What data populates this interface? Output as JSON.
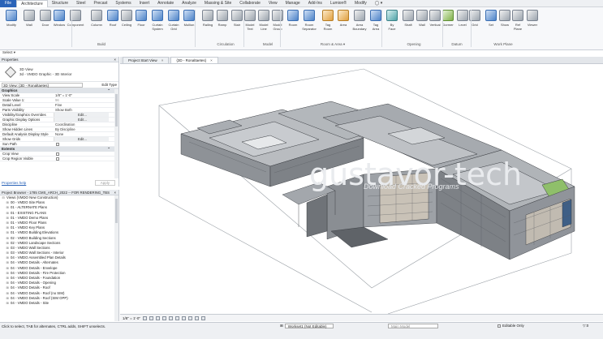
{
  "ribbon_tabs": [
    "File",
    "Architecture",
    "Structure",
    "Steel",
    "Precast",
    "Systems",
    "Insert",
    "Annotate",
    "Analyze",
    "Massing & Site",
    "Collaborate",
    "View",
    "Manage",
    "Add-Ins",
    "Lumion®",
    "Modify",
    "◯ ▾"
  ],
  "ribbon_active_tab": "Architecture",
  "tools": [
    {
      "label": "Modify",
      "color": "blue"
    },
    {
      "label": "Wall",
      "color": "grey"
    },
    {
      "label": "Door",
      "color": "grey"
    },
    {
      "label": "Window",
      "color": "blue"
    },
    {
      "label": "Component",
      "color": "grey"
    },
    {
      "label": "Column",
      "color": "grey"
    },
    {
      "label": "Roof",
      "color": "blue"
    },
    {
      "label": "Ceiling",
      "color": "grey"
    },
    {
      "label": "Floor",
      "color": "blue"
    },
    {
      "label": "Curtain\nSystem",
      "color": "blue"
    },
    {
      "label": "Curtain\nGrid",
      "color": "blue"
    },
    {
      "label": "Mullion",
      "color": "blue"
    },
    {
      "label": "Railing",
      "color": "grey"
    },
    {
      "label": "Ramp",
      "color": "grey"
    },
    {
      "label": "Stair",
      "color": "grey"
    },
    {
      "label": "Model\nText",
      "color": "grey"
    },
    {
      "label": "Model\nLine",
      "color": "grey"
    },
    {
      "label": "Model\nGroup",
      "color": "grey"
    },
    {
      "label": "Room",
      "color": "blue"
    },
    {
      "label": "Room\nSeparator",
      "color": "blue"
    },
    {
      "label": "Tag\nRoom",
      "color": "orange"
    },
    {
      "label": "Area",
      "color": "orange"
    },
    {
      "label": "Area\nBoundary",
      "color": "grey"
    },
    {
      "label": "Tag\nArea",
      "color": "blue"
    },
    {
      "label": "By\nFace",
      "color": "teal"
    },
    {
      "label": "Shaft",
      "color": "grey"
    },
    {
      "label": "Wall",
      "color": "grey"
    },
    {
      "label": "Vertical",
      "color": "grey"
    },
    {
      "label": "Dormer",
      "color": "green"
    },
    {
      "label": "Level",
      "color": "grey"
    },
    {
      "label": "Grid",
      "color": "grey"
    },
    {
      "label": "Set",
      "color": "blue"
    },
    {
      "label": "Show",
      "color": "grey"
    },
    {
      "label": "Ref\nPlane",
      "color": "grey"
    },
    {
      "label": "Viewer",
      "color": "grey"
    }
  ],
  "ribbon_groups": [
    "Select ▾",
    "Build",
    "Circulation",
    "Model",
    "Room & Area ▾",
    "Opening",
    "Datum",
    "Work Plane"
  ],
  "properties": {
    "title": "Properties",
    "type_line1": "3D View",
    "type_line2": "3d - VMDO Graphic - 3D Interior",
    "view_selector": "3D View: {3D - Ronaltaetes}",
    "edit_type": "Edit Type",
    "section_graphics": "Graphics",
    "rows": [
      {
        "k": "View Scale",
        "v": "1/8\" = 1'-0\""
      },
      {
        "k": "Scale Value 1:",
        "v": "96",
        "muted": true
      },
      {
        "k": "Detail Level",
        "v": "Fine"
      },
      {
        "k": "Parts Visibility",
        "v": "Show Both"
      },
      {
        "k": "Visibility/Graphics Overrides",
        "v": "Edit...",
        "btn": true
      },
      {
        "k": "Graphic Display Options",
        "v": "Edit...",
        "btn": true
      },
      {
        "k": "Discipline",
        "v": "Coordination"
      },
      {
        "k": "Show Hidden Lines",
        "v": "By Discipline"
      },
      {
        "k": "Default Analysis Display Style",
        "v": "None"
      },
      {
        "k": "Show Grids",
        "v": "Edit...",
        "btn": true
      },
      {
        "k": "Sun Path",
        "v": "",
        "chk": true
      }
    ],
    "section_extents": "Extents",
    "rows2": [
      {
        "k": "Crop View",
        "v": "",
        "chk": true
      },
      {
        "k": "Crop Region Visible",
        "v": "",
        "chk": true
      }
    ],
    "help": "Properties help",
    "apply": "Apply"
  },
  "browser": {
    "title": "Project Browser - 1785 CMS_ARCH_2022 -- FOR RENDERING_TBS",
    "items": [
      {
        "t": "Views (VMDO New Construction)",
        "e": "⊟",
        "indent": 0
      },
      {
        "t": "00 - VMDO Site Plans",
        "e": "⊞",
        "indent": 1
      },
      {
        "t": "01 - ALTERNATE Plans",
        "e": "⊞",
        "indent": 1
      },
      {
        "t": "01 - EXISTING PLANS",
        "e": "⊞",
        "indent": 1
      },
      {
        "t": "01 - VMDO Demo Plans",
        "e": "⊞",
        "indent": 1
      },
      {
        "t": "01 - VMDO Floor Plans",
        "e": "⊞",
        "indent": 1
      },
      {
        "t": "01 - VMDO Key Plans",
        "e": "⊞",
        "indent": 1
      },
      {
        "t": "01 - VMDO Building Elevations",
        "e": "⊞",
        "indent": 1
      },
      {
        "t": "02 - VMDO Building Sections",
        "e": "⊞",
        "indent": 1
      },
      {
        "t": "02 - VMDO Landscape Sections",
        "e": "⊞",
        "indent": 1
      },
      {
        "t": "03 - VMDO Wall Sections",
        "e": "⊞",
        "indent": 1
      },
      {
        "t": "03 - VMDO Wall Sections - Interior",
        "e": "⊞",
        "indent": 1
      },
      {
        "t": "04 - VMDO Assembled Plan Details",
        "e": "⊞",
        "indent": 1
      },
      {
        "t": "04 - VMDO Details - Alternates",
        "e": "⊞",
        "indent": 1
      },
      {
        "t": "04 - VMDO Details - Envelope",
        "e": "⊞",
        "indent": 1
      },
      {
        "t": "04 - VMDO Details - Fire Protection",
        "e": "⊞",
        "indent": 1
      },
      {
        "t": "04 - VMDO Details - Foundation",
        "e": "⊞",
        "indent": 1
      },
      {
        "t": "04 - VMDO Details - Opening",
        "e": "⊞",
        "indent": 1
      },
      {
        "t": "04 - VMDO Details - Roof",
        "e": "⊞",
        "indent": 1
      },
      {
        "t": "04 - VMDO Details - Roof (no SIM)",
        "e": "⊞",
        "indent": 1
      },
      {
        "t": "04 - VMDO Details - Roof (SIM OPP)",
        "e": "⊞",
        "indent": 1
      },
      {
        "t": "04 - VMDO Details - Site",
        "e": "⊞",
        "indent": 1
      }
    ]
  },
  "view_tabs": [
    {
      "label": "Project Start View",
      "active": false
    },
    {
      "label": "{3D - Ronaltaetes}",
      "active": true
    }
  ],
  "watermark": "gustavor-tech",
  "watermark_sub": "Download Cracked Programs",
  "view_scale": "1/8\" = 1'-0\"",
  "status": {
    "message": "Click to select, TAB for alternates, CTRL adds, SHIFT unselects.",
    "workset": "Workset1 (Not Editable)",
    "model": "Main Model",
    "editable": "Editable Only",
    "filter": "▽:0"
  }
}
